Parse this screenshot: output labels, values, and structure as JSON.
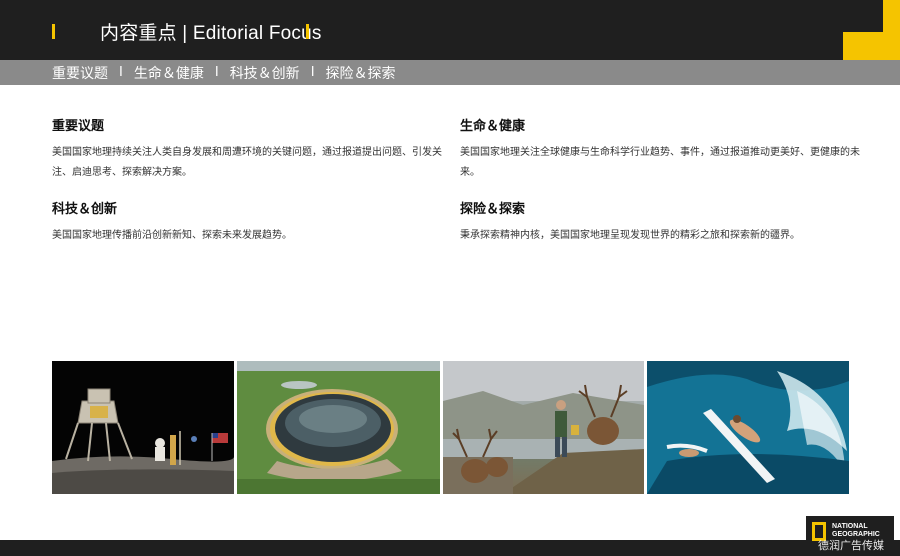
{
  "header": {
    "title": "内容重点 | Editorial Focus",
    "accent_color": "#f5c400",
    "background": "#1f1f1f"
  },
  "subnav": {
    "items": [
      "重要议题",
      "生命＆健康",
      "科技＆创新",
      "探险＆探索"
    ],
    "separator": "I"
  },
  "sections": [
    {
      "title": "重要议题",
      "body": "美国国家地理持续关注人类自身发展和周遭环境的关键问题，通过报道提出问题、引发关注、启迪思考、探索解决方案。"
    },
    {
      "title": "生命＆健康",
      "body": "美国国家地理关注全球健康与生命科学行业趋势、事件，通过报道推动更美好、更健康的未来。"
    },
    {
      "title": "科技＆创新",
      "body": "美国国家地理传播前沿创新新知、探索未来发展趋势。"
    },
    {
      "title": "探险＆探索",
      "body": "秉承探索精神内核，美国国家地理呈现发现世界的精彩之旅和探索新的疆界。"
    }
  ],
  "photos": [
    {
      "icon": "moon-landing-photo"
    },
    {
      "icon": "crater-aerial-photo"
    },
    {
      "icon": "deer-mountain-photo"
    },
    {
      "icon": "surfer-wave-photo"
    }
  ],
  "logo": {
    "line1": "NATIONAL",
    "line2": "GEOGRAPHIC"
  },
  "watermark": "德润广告传媒"
}
